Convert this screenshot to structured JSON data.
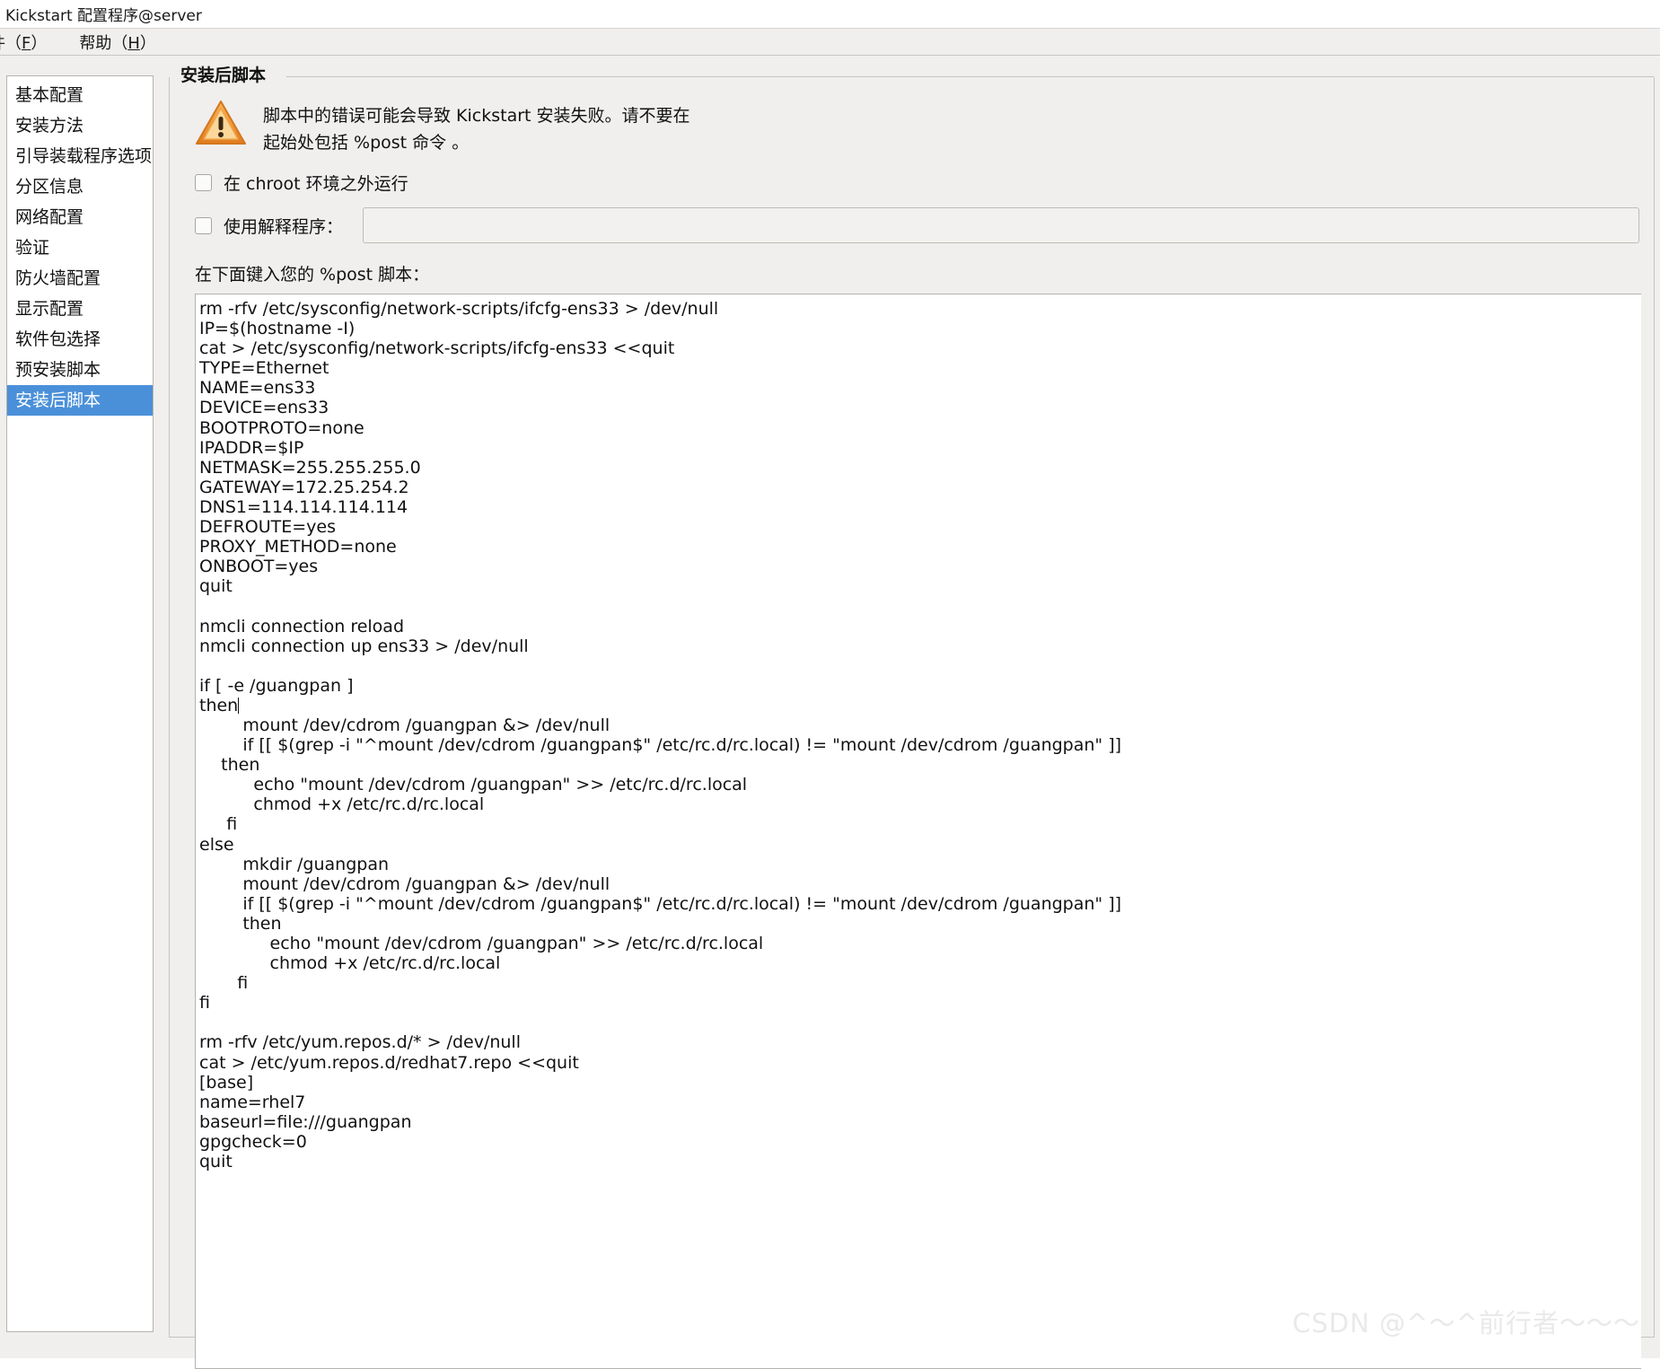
{
  "window": {
    "title": "Kickstart 配置程序@server"
  },
  "menubar": {
    "items": [
      {
        "label": "件（",
        "mnemonic": "F",
        "suffix": "）",
        "name": "menu-file"
      },
      {
        "label": "帮助（",
        "mnemonic": "H",
        "suffix": "）",
        "name": "menu-help"
      }
    ]
  },
  "sidebar": {
    "items": [
      {
        "label": "基本配置",
        "selected": false
      },
      {
        "label": "安装方法",
        "selected": false
      },
      {
        "label": "引导装载程序选项",
        "selected": false
      },
      {
        "label": "分区信息",
        "selected": false
      },
      {
        "label": "网络配置",
        "selected": false
      },
      {
        "label": "验证",
        "selected": false
      },
      {
        "label": "防火墙配置",
        "selected": false
      },
      {
        "label": "显示配置",
        "selected": false
      },
      {
        "label": "软件包选择",
        "selected": false
      },
      {
        "label": "预安装脚本",
        "selected": false
      },
      {
        "label": "安装后脚本",
        "selected": true
      }
    ]
  },
  "panel": {
    "group_title": "安装后脚本",
    "warning_icon": "warning-triangle-icon",
    "warning_text": "脚本中的错误可能会导致 Kickstart 安装失败。请不要在\n起始处包括 %post 命令 。",
    "checkbox_chroot": {
      "label": "在 chroot 环境之外运行",
      "checked": false
    },
    "checkbox_interpreter": {
      "label": "使用解释程序：",
      "checked": false
    },
    "interpreter_input": {
      "value": "",
      "placeholder": ""
    },
    "script_prompt": "在下面键入您的 %post 脚本：",
    "script_lines": [
      "rm -rfv /etc/sysconfig/network-scripts/ifcfg-ens33 > /dev/null",
      "IP=$(hostname -I)",
      "cat > /etc/sysconfig/network-scripts/ifcfg-ens33 <<quit",
      "TYPE=Ethernet",
      "NAME=ens33",
      "DEVICE=ens33",
      "BOOTPROTO=none",
      "IPADDR=$IP",
      "NETMASK=255.255.255.0",
      "GATEWAY=172.25.254.2",
      "DNS1=114.114.114.114",
      "DEFROUTE=yes",
      "PROXY_METHOD=none",
      "ONBOOT=yes",
      "quit",
      "",
      "nmcli connection reload",
      "nmcli connection up ens33 > /dev/null",
      "",
      "if [ -e /guangpan ]",
      "then",
      "        mount /dev/cdrom /guangpan &> /dev/null",
      "        if [[ $(grep -i \"^mount /dev/cdrom /guangpan$\" /etc/rc.d/rc.local) != \"mount /dev/cdrom /guangpan\" ]]",
      "    then",
      "          echo \"mount /dev/cdrom /guangpan\" >> /etc/rc.d/rc.local",
      "          chmod +x /etc/rc.d/rc.local",
      "     fi",
      "else",
      "        mkdir /guangpan",
      "        mount /dev/cdrom /guangpan &> /dev/null",
      "        if [[ $(grep -i \"^mount /dev/cdrom /guangpan$\" /etc/rc.d/rc.local) != \"mount /dev/cdrom /guangpan\" ]]",
      "        then",
      "             echo \"mount /dev/cdrom /guangpan\" >> /etc/rc.d/rc.local",
      "             chmod +x /etc/rc.d/rc.local",
      "       fi",
      "fi",
      "",
      "rm -rfv /etc/yum.repos.d/* > /dev/null",
      "cat > /etc/yum.repos.d/redhat7.repo <<quit",
      "[base]",
      "name=rhel7",
      "baseurl=file:///guangpan",
      "gpgcheck=0",
      "quit"
    ],
    "caret_after_line_index": 20
  },
  "watermark": {
    "text": "CSDN @^～^前行者～～～"
  },
  "colors": {
    "selection_blue": "#4a90d9",
    "panel_bg": "#f0efee",
    "warning_orange": "#f0963c",
    "text": "#111111"
  }
}
